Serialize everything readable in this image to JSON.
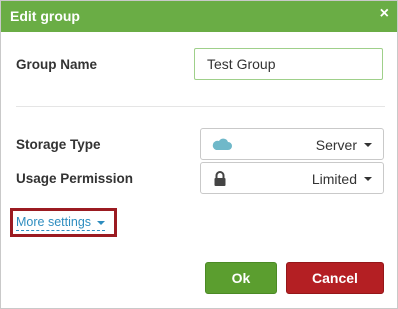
{
  "dialog": {
    "title": "Edit group",
    "close_glyph": "×",
    "header_color": "#6aad45"
  },
  "form": {
    "group_name_label": "Group Name",
    "group_name_value": "Test Group",
    "storage_type_label": "Storage Type",
    "storage_type_value": "Server",
    "storage_type_icon": "cloud-icon",
    "usage_permission_label": "Usage Permission",
    "usage_permission_value": "Limited",
    "usage_permission_icon": "lock-icon",
    "more_settings_label": "More settings"
  },
  "buttons": {
    "ok_label": "Ok",
    "cancel_label": "Cancel",
    "ok_color": "#5b9e2f",
    "cancel_color": "#b41f23"
  }
}
